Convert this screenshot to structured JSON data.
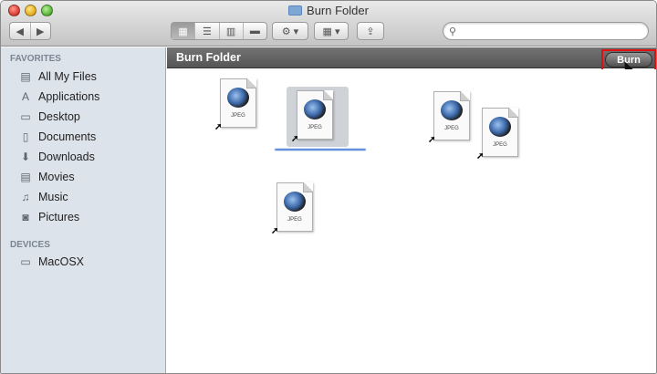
{
  "window": {
    "title": "Burn Folder"
  },
  "toolbar": {
    "back_icon": "chevron-left-icon",
    "forward_icon": "chevron-right-icon",
    "view_modes": [
      "icon-view-icon",
      "list-view-icon",
      "column-view-icon",
      "coverflow-view-icon"
    ],
    "action_icon": "gear-icon",
    "arrange_icon": "grid-icon",
    "share_icon": "share-icon",
    "search_placeholder": ""
  },
  "sidebar": {
    "favorites_header": "FAVORITES",
    "favorites": [
      {
        "label": "All My Files",
        "icon": "all-files-icon"
      },
      {
        "label": "Applications",
        "icon": "applications-icon"
      },
      {
        "label": "Desktop",
        "icon": "desktop-icon"
      },
      {
        "label": "Documents",
        "icon": "documents-icon"
      },
      {
        "label": "Downloads",
        "icon": "downloads-icon"
      },
      {
        "label": "Movies",
        "icon": "movies-icon"
      },
      {
        "label": "Music",
        "icon": "music-icon"
      },
      {
        "label": "Pictures",
        "icon": "pictures-icon"
      }
    ],
    "devices_header": "DEVICES",
    "devices": [
      {
        "label": "MacOSX",
        "icon": "hard-drive-icon"
      }
    ]
  },
  "pathbar": {
    "label": "Burn Folder",
    "burn_label": "Burn"
  },
  "files": [
    {
      "tag": "JPEG",
      "label_line1": "",
      "label_line2": "",
      "selected": false
    },
    {
      "tag": "JPEG",
      "label_line1": "",
      "label_line2": "",
      "selected": true
    },
    {
      "tag": "JPEG",
      "label_line1": "",
      "label_line2": "",
      "selected": false
    },
    {
      "tag": "JPEG",
      "label_line1": "",
      "label_line2": "",
      "selected": false
    },
    {
      "tag": "JPEG",
      "label_line1": "",
      "label_line2": "",
      "selected": false
    }
  ],
  "colors": {
    "sidebar_bg": "#dde3ea",
    "pathbar_bg": "#555555",
    "selection_blue": "#3b73d4",
    "highlight_red": "#e01010"
  }
}
